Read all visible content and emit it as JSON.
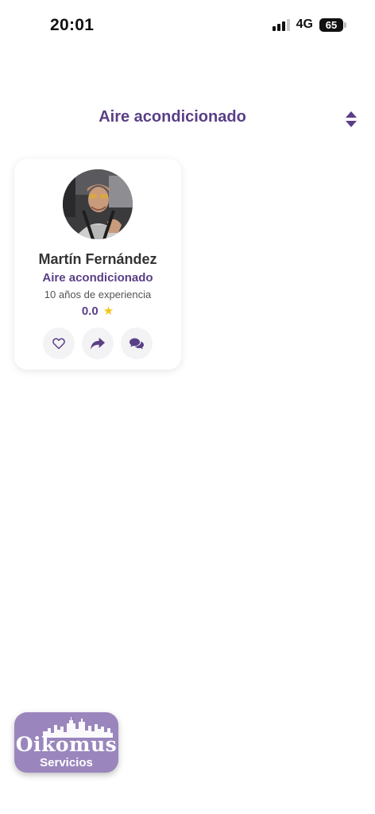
{
  "status_bar": {
    "time": "20:01",
    "network": "4G",
    "battery": "65"
  },
  "header": {
    "title": "Aire acondicionado",
    "sort_icon": "sort-icon"
  },
  "providers": [
    {
      "name": "Martín Fernández",
      "specialty": "Aire acondicionado",
      "experience": "10 años de experiencia",
      "rating": "0.0",
      "actions": [
        "heart-icon",
        "share-icon",
        "chat-icon"
      ]
    }
  ],
  "logo": {
    "title": "Oikomus",
    "subtitle": "Servicios"
  },
  "colors": {
    "accent": "#5a3f87",
    "logo_bg": "#9a86bd",
    "star": "#f5c518"
  }
}
